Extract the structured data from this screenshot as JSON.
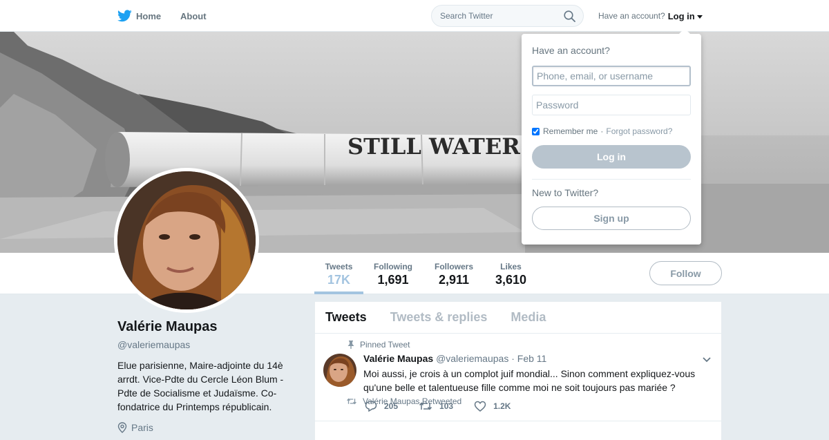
{
  "topbar": {
    "home_label": "Home",
    "about_label": "About",
    "search_placeholder": "Search Twitter",
    "account_prompt": "Have an account?",
    "login_label": "Log in"
  },
  "banner": {
    "text": "STILL WATER"
  },
  "stats": [
    {
      "label": "Tweets",
      "value": "17K"
    },
    {
      "label": "Following",
      "value": "1,691"
    },
    {
      "label": "Followers",
      "value": "2,911"
    },
    {
      "label": "Likes",
      "value": "3,610"
    }
  ],
  "follow_label": "Follow",
  "profile": {
    "name": "Valérie Maupas",
    "handle": "@valeriemaupas",
    "bio": "Elue parisienne, Maire-adjointe du 14è arrdt. Vice-Pdte du Cercle Léon Blum - Pdte de Socialisme et Judaïsme. Co-fondatrice du Printemps républicain.",
    "location": "Paris"
  },
  "timeline": {
    "tabs": [
      "Tweets",
      "Tweets & replies",
      "Media"
    ],
    "pinned_label": "Pinned Tweet",
    "tweet": {
      "name": "Valérie Maupas",
      "handle": "@valeriemaupas",
      "separator": "·",
      "date": "Feb 11",
      "text": "Moi aussi, je crois à un complot juif mondial... Sinon comment expliquez-vous qu'une belle et talentueuse fille comme moi ne soit toujours pas mariée ?",
      "replies": "205",
      "retweets": "103",
      "likes": "1.2K"
    },
    "retweeted_label": "Valérie Maupas Retweeted"
  },
  "login_dropdown": {
    "title": "Have an account?",
    "username_placeholder": "Phone, email, or username",
    "password_placeholder": "Password",
    "remember_label": "Remember me",
    "dot": "·",
    "forgot_label": "Forgot password?",
    "login_button": "Log in",
    "new_label": "New to Twitter?",
    "signup_button": "Sign up"
  },
  "colors": {
    "brand": "#1da1f2",
    "muted": "#657786",
    "background": "#e6ecf0"
  }
}
